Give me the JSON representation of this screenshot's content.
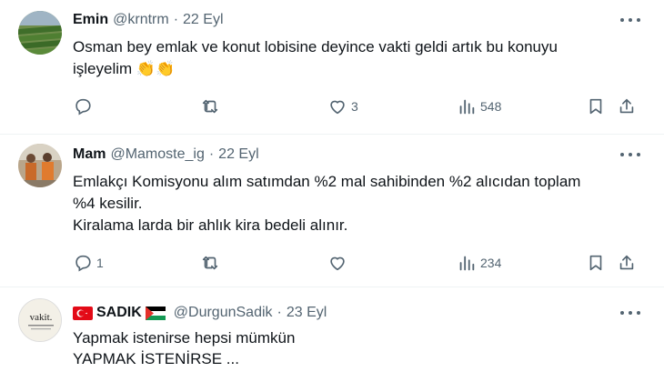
{
  "tweets": [
    {
      "name": "Emin",
      "handle": "@krntrm",
      "time": "22 Eyl",
      "lines": [
        "Osman bey emlak ve konut lobisine deyince vakti geldi artık bu konuyu",
        "işleyelim 👏👏"
      ],
      "replies": "",
      "retweets": "",
      "likes": "3",
      "views": "548"
    },
    {
      "name": "Mam",
      "handle": "@Mamoste_ig",
      "time": "22 Eyl",
      "lines": [
        "Emlakçı Komisyonu alım satımdan %2 mal sahibinden %2 alıcıdan toplam",
        "%4 kesilir.",
        "Kiralama larda bir ahlık kira bedeli alınır."
      ],
      "replies": "1",
      "retweets": "",
      "likes": "",
      "views": "234"
    },
    {
      "name": "SADIK",
      "handle": "@DurgunSadik",
      "time": "23 Eyl",
      "lines": [
        "Yapmak istenirse hepsi mümkün",
        "YAPMAK İSTENİRSE ..."
      ],
      "avatar_text": "vakit."
    }
  ],
  "icons": {
    "reply": "reply-icon",
    "retweet": "retweet-icon",
    "like": "heart-icon",
    "views": "views-icon",
    "bookmark": "bookmark-icon",
    "share": "share-icon",
    "more": "more-icon"
  },
  "colors": {
    "text": "#0f1419",
    "secondary": "#536471",
    "divider": "#eff3f4",
    "turkey_red": "#e30a17",
    "palestine_green": "#149954"
  }
}
